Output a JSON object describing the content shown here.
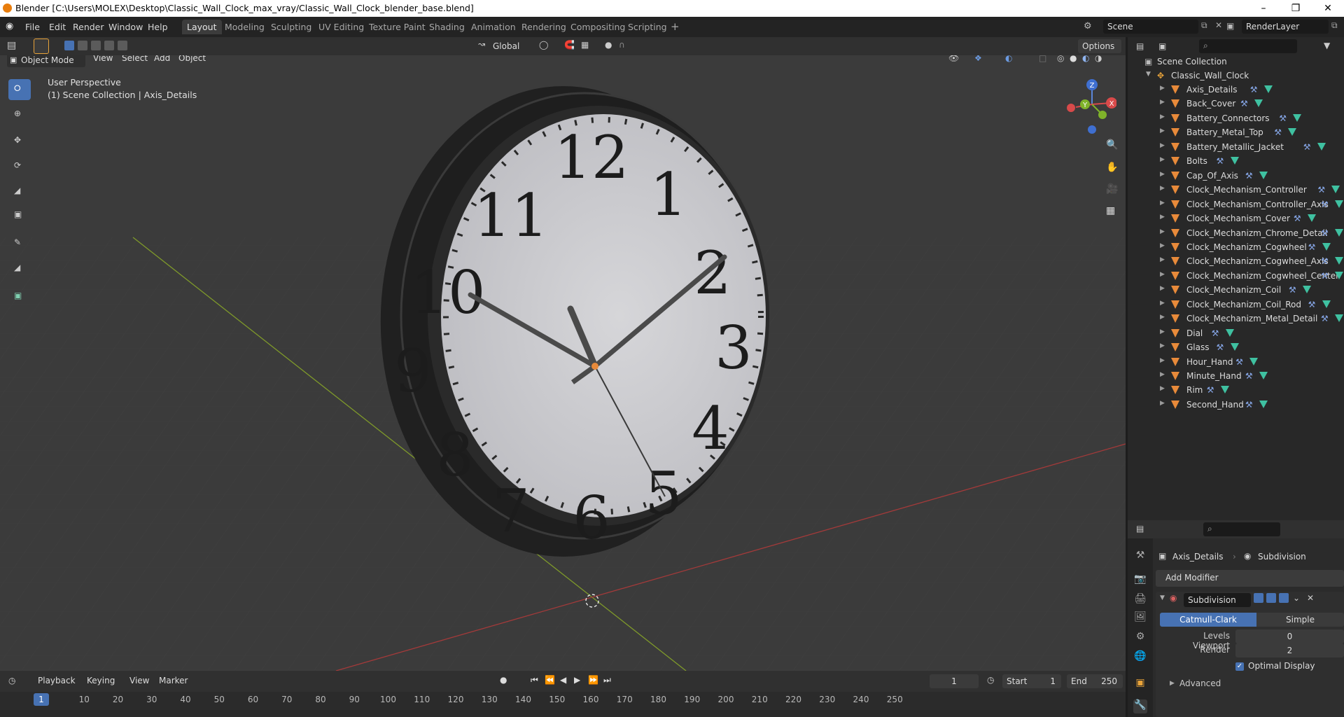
{
  "window": {
    "title": "Blender [C:\\Users\\MOLEX\\Desktop\\Classic_Wall_Clock_max_vray/Classic_Wall_Clock_blender_base.blend]"
  },
  "menu": [
    "File",
    "Edit",
    "Render",
    "Window",
    "Help"
  ],
  "workspaces": [
    "Layout",
    "Modeling",
    "Sculpting",
    "UV Editing",
    "Texture Paint",
    "Shading",
    "Animation",
    "Rendering",
    "Compositing",
    "Scripting"
  ],
  "active_workspace": "Layout",
  "scene_name": "Scene",
  "render_layer": "RenderLayer",
  "viewport": {
    "mode": "Object Mode",
    "menus": [
      "View",
      "Select",
      "Add",
      "Object"
    ],
    "transform_orientation": "Global",
    "options_label": "Options",
    "overlay_title": "User Perspective",
    "overlay_subtitle": "(1) Scene Collection | Axis_Details",
    "gizmo_axes": {
      "x": "X",
      "y": "Y",
      "z": "Z"
    },
    "clock_numerals": [
      "12",
      "1",
      "2",
      "3",
      "4",
      "5",
      "6",
      "7",
      "8",
      "9",
      "10",
      "11"
    ]
  },
  "timeline": {
    "menus": [
      "Playback",
      "Keying",
      "View",
      "Marker"
    ],
    "current_frame": "1",
    "start_label": "Start",
    "start": "1",
    "end_label": "End",
    "end": "250",
    "ticks": [
      "1",
      "10",
      "20",
      "30",
      "40",
      "50",
      "60",
      "70",
      "80",
      "90",
      "100",
      "110",
      "120",
      "130",
      "140",
      "150",
      "160",
      "170",
      "180",
      "190",
      "200",
      "210",
      "220",
      "230",
      "240",
      "250"
    ]
  },
  "outliner": {
    "root": "Scene Collection",
    "collection": "Classic_Wall_Clock",
    "objects": [
      "Axis_Details",
      "Back_Cover",
      "Battery_Connectors",
      "Battery_Metal_Top",
      "Battery_Metallic_Jacket",
      "Bolts",
      "Cap_Of_Axis",
      "Clock_Mechanism_Controller",
      "Clock_Mechanism_Controller_Axis",
      "Clock_Mechanism_Cover",
      "Clock_Mechanizm_Chrome_Detail",
      "Clock_Mechanizm_Cogwheel",
      "Clock_Mechanizm_Cogwheel_Axis",
      "Clock_Mechanizm_Cogwheel_Center",
      "Clock_Mechanizm_Coil",
      "Clock_Mechanizm_Coil_Rod",
      "Clock_Mechanizm_Metal_Detail",
      "Dial",
      "Glass",
      "Hour_Hand",
      "Minute_Hand",
      "Rim",
      "Second_Hand"
    ]
  },
  "properties": {
    "breadcrumb_object": "Axis_Details",
    "breadcrumb_modifier": "Subdivision",
    "add_modifier": "Add Modifier",
    "modifier_name": "Subdivision",
    "algo_options": [
      "Catmull-Clark",
      "Simple"
    ],
    "selected_algo": "Catmull-Clark",
    "levels_viewport_label": "Levels Viewport",
    "levels_viewport": "0",
    "render_label": "Render",
    "render": "2",
    "optimal_display": "Optimal Display",
    "advanced": "Advanced"
  },
  "colors": {
    "accent": "#4772b3",
    "object_icon": "#e88a3a",
    "mesh_icon": "#3fc1a1"
  }
}
